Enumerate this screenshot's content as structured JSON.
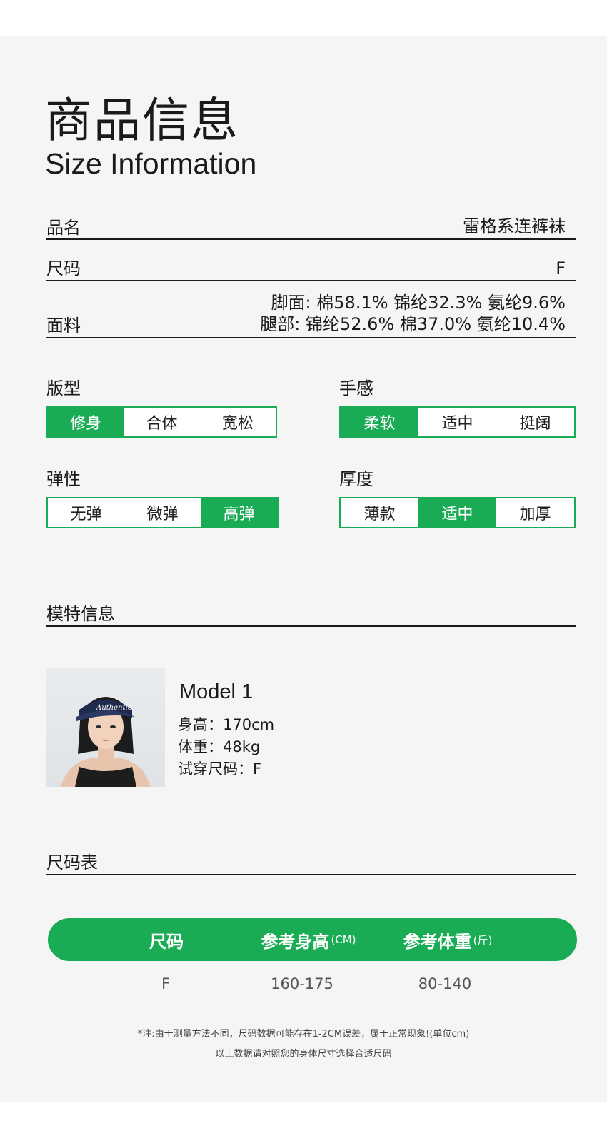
{
  "header": {
    "title_cn": "商品信息",
    "title_en": "Size Information"
  },
  "info_rows": [
    {
      "label": "品名",
      "value": "雷格系连裤袜"
    },
    {
      "label": "尺码",
      "value": "F"
    },
    {
      "label": "面料",
      "value_line1": "脚面: 棉58.1% 锦纶32.3% 氨纶9.6%",
      "value_line2": "腿部: 锦纶52.6%  棉37.0%  氨纶10.4%"
    }
  ],
  "attributes": [
    {
      "title": "版型",
      "options": [
        "修身",
        "合体",
        "宽松"
      ],
      "selected": 0
    },
    {
      "title": "手感",
      "options": [
        "柔软",
        "适中",
        "挺阔"
      ],
      "selected": 0
    },
    {
      "title": "弹性",
      "options": [
        "无弹",
        "微弹",
        "高弹"
      ],
      "selected": 2
    },
    {
      "title": "厚度",
      "options": [
        "薄款",
        "适中",
        "加厚"
      ],
      "selected": 1
    }
  ],
  "model_section": {
    "title": "模特信息",
    "name": "Model 1",
    "height": "身高：170cm",
    "weight": "体重：48kg",
    "size": "试穿尺码：F",
    "cap_text": "Authentic"
  },
  "size_table": {
    "title": "尺码表",
    "headers": [
      {
        "main": "尺码",
        "unit": ""
      },
      {
        "main": "参考身高",
        "unit": "(CM)"
      },
      {
        "main": "参考体重",
        "unit": "(斤)"
      }
    ],
    "rows": [
      [
        "F",
        "160-175",
        "80-140"
      ]
    ]
  },
  "notes": {
    "line1": "*注:由于测量方法不同，尺码数据可能存在1-2CM误差，属于正常现象!(单位cm)",
    "line2": "以上数据请对照您的身体尺寸选择合适尺码"
  },
  "colors": {
    "accent": "#1aab55",
    "panel": "#f5f5f5"
  }
}
